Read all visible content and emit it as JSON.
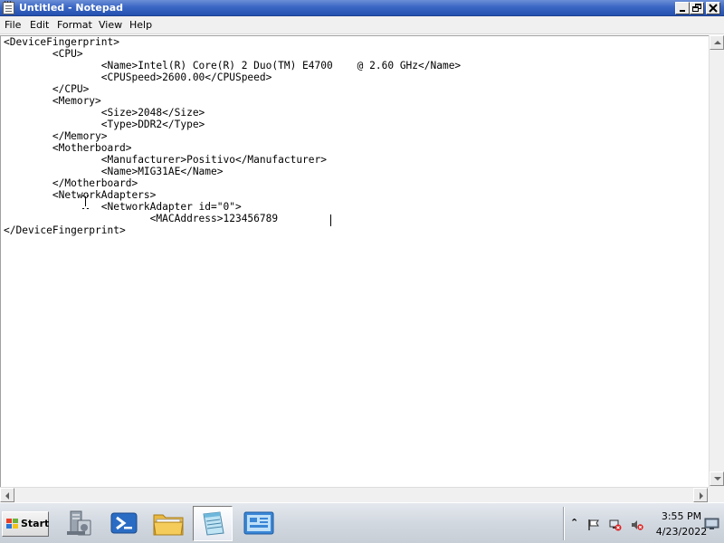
{
  "window": {
    "title": "Untitled - Notepad"
  },
  "menu": {
    "file": "File",
    "edit": "Edit",
    "format": "Format",
    "view": "View",
    "help": "Help"
  },
  "editor": {
    "content": "<DeviceFingerprint>\n\t<CPU>\n\t\t<Name>Intel(R) Core(R) 2 Duo(TM) E4700    @ 2.60 GHz</Name>\n\t\t<CPUSpeed>2600.00</CPUSpeed>\n\t</CPU>\n\t<Memory>\n\t\t<Size>2048</Size>\n\t\t<Type>DDR2</Type>\n\t</Memory>\n\t<Motherboard>\n\t\t<Manufacturer>Positivo</Manufacturer>\n\t\t<Name>MIG31AE</Name>\n\t</Motherboard>\n\t<NetworkAdapters>\n\t\t<NetworkAdapter id=\"0\">\n\t\t\t<MACAddress>123456789\n</DeviceFingerprint>"
  },
  "taskbar": {
    "start_label": "Start",
    "items": [
      {
        "icon": "server-manager-icon"
      },
      {
        "icon": "powershell-icon"
      },
      {
        "icon": "explorer-folder-icon"
      },
      {
        "icon": "notepad-icon",
        "active": true
      },
      {
        "icon": "control-panel-icon"
      }
    ]
  },
  "tray": {
    "time": "3:55 PM",
    "date": "4/23/2022",
    "icons": [
      "show-hidden-icons-chevron",
      "action-center-flag-icon",
      "network-icon",
      "volume-muted-icon",
      "show-desktop-icon"
    ]
  },
  "colors": {
    "titlebar": "#3b67c4",
    "menubar": "#f0f0f0",
    "taskbar": "#d2d8e0"
  }
}
